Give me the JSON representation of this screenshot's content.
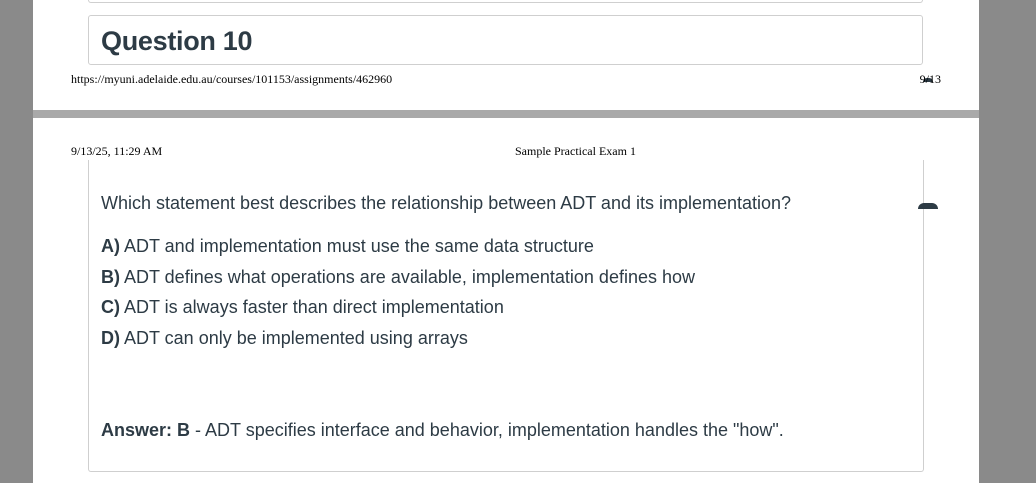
{
  "top_page": {
    "question_title": "Question 10",
    "footer": {
      "url": "https://myuni.adelaide.edu.au/courses/101153/assignments/462960",
      "page": "9/13"
    }
  },
  "bottom_page": {
    "header": {
      "datetime": "9/13/25, 11:29 AM",
      "title": "Sample Practical Exam 1"
    },
    "question_text": "Which statement best describes the relationship between ADT and its implementation?",
    "options": [
      {
        "letter": "A)",
        "text": "ADT and implementation must use the same data structure"
      },
      {
        "letter": "B)",
        "text": "ADT defines what operations are available, implementation defines how"
      },
      {
        "letter": "C)",
        "text": "ADT is always faster than direct implementation"
      },
      {
        "letter": "D)",
        "text": "ADT can only be implemented using arrays"
      }
    ],
    "answer": {
      "label": "Answer: B",
      "text": " - ADT specifies interface and behavior, implementation handles the \"how\"."
    }
  },
  "colors": {
    "background": "#8a8a8a",
    "page": "#ffffff",
    "text": "#2d3b45",
    "border": "#cfcfcf"
  }
}
